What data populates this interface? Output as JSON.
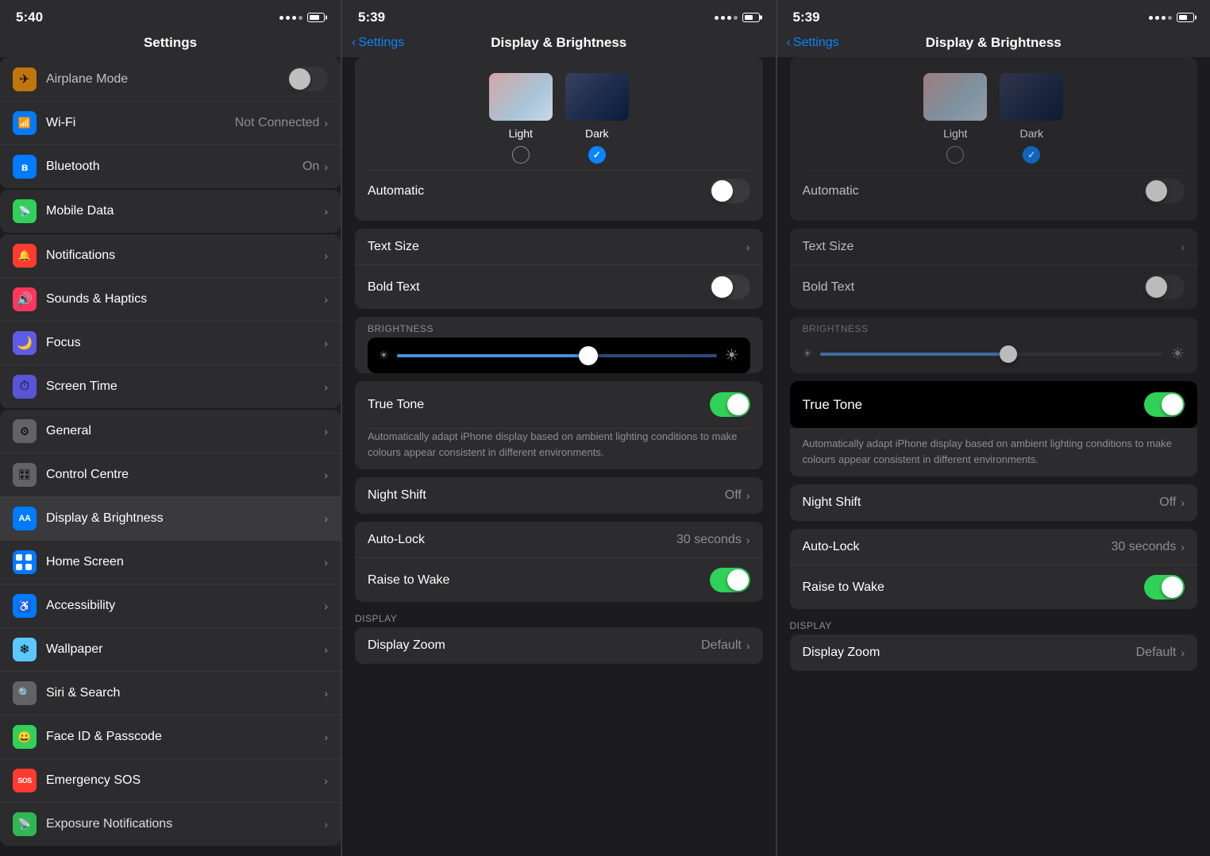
{
  "panels": [
    {
      "id": "panel-settings",
      "status": {
        "time": "5:40",
        "signal": [
          true,
          true,
          true,
          true
        ],
        "battery": 60
      },
      "hasBack": false,
      "title": "Settings",
      "sections": [
        {
          "items": [
            {
              "icon": "✈",
              "bg": "bg-orange",
              "label": "Airplane Mode",
              "value": "",
              "hasToggle": true,
              "toggleOn": false,
              "hasChevron": false
            },
            {
              "icon": "📶",
              "bg": "bg-blue",
              "label": "Wi-Fi",
              "value": "Not Connected",
              "hasChevron": true
            },
            {
              "icon": "🔵",
              "bg": "bg-blue",
              "label": "Bluetooth",
              "value": "On",
              "hasChevron": true
            }
          ]
        },
        {
          "items": [
            {
              "icon": "📱",
              "bg": "bg-green",
              "label": "Mobile Data",
              "value": "",
              "hasChevron": true
            }
          ]
        },
        {
          "items": [
            {
              "icon": "🔔",
              "bg": "bg-red",
              "label": "Notifications",
              "value": "",
              "hasChevron": true
            },
            {
              "icon": "🔊",
              "bg": "bg-pink",
              "label": "Sounds & Haptics",
              "value": "",
              "hasChevron": true
            },
            {
              "icon": "🌙",
              "bg": "bg-indigo",
              "label": "Focus",
              "value": "",
              "hasChevron": true
            },
            {
              "icon": "⏱",
              "bg": "bg-purple",
              "label": "Screen Time",
              "value": "",
              "hasChevron": true
            }
          ]
        },
        {
          "items": [
            {
              "icon": "⚙",
              "bg": "bg-gray",
              "label": "General",
              "value": "",
              "hasChevron": true
            },
            {
              "icon": "🎛",
              "bg": "bg-gray",
              "label": "Control Centre",
              "value": "",
              "hasChevron": true
            },
            {
              "icon": "AA",
              "bg": "bg-aa",
              "label": "Display & Brightness",
              "value": "",
              "hasChevron": true,
              "selected": true
            },
            {
              "icon": "⊞",
              "bg": "bg-blue",
              "label": "Home Screen",
              "value": "",
              "hasChevron": true
            },
            {
              "icon": "♿",
              "bg": "bg-blue",
              "label": "Accessibility",
              "value": "",
              "hasChevron": true
            },
            {
              "icon": "❄",
              "bg": "bg-cyan",
              "label": "Wallpaper",
              "value": "",
              "hasChevron": true
            },
            {
              "icon": "🔍",
              "bg": "bg-gray",
              "label": "Siri & Search",
              "value": "",
              "hasChevron": true
            },
            {
              "icon": "😀",
              "bg": "bg-green",
              "label": "Face ID & Passcode",
              "value": "",
              "hasChevron": true
            },
            {
              "icon": "SOS",
              "bg": "bg-red",
              "label": "Emergency SOS",
              "value": "",
              "hasChevron": true
            },
            {
              "icon": "📡",
              "bg": "bg-green",
              "label": "Exposure Notifications",
              "value": "",
              "hasChevron": true
            }
          ]
        }
      ]
    },
    {
      "id": "panel-display-1",
      "status": {
        "time": "5:39",
        "signal": [
          true,
          true,
          true,
          false
        ],
        "battery": 50
      },
      "hasBack": true,
      "backLabel": "Settings",
      "title": "Display & Brightness",
      "appearance": {
        "lightLabel": "Light",
        "darkLabel": "Dark",
        "selectedMode": "dark",
        "automaticLabel": "Automatic",
        "automaticOn": false
      },
      "textSection": {
        "textSizeLabel": "Text Size",
        "boldTextLabel": "Bold Text",
        "boldTextOn": false
      },
      "brightness": {
        "sectionLabel": "BRIGHTNESS",
        "sliderPercent": 55
      },
      "trueTone": {
        "label": "True Tone",
        "on": true,
        "description": "Automatically adapt iPhone display based on ambient lighting conditions to make colours appear consistent in different environments."
      },
      "nightShift": {
        "label": "Night Shift",
        "value": "Off"
      },
      "autoLock": {
        "label": "Auto-Lock",
        "value": "30 seconds"
      },
      "raiseToWake": {
        "label": "Raise to Wake",
        "on": true
      },
      "displaySection": {
        "sectionLabel": "DISPLAY",
        "displayZoom": {
          "label": "Display Zoom",
          "value": "Default"
        }
      }
    },
    {
      "id": "panel-display-2",
      "status": {
        "time": "5:39",
        "signal": [
          true,
          true,
          true,
          false
        ],
        "battery": 50
      },
      "hasBack": true,
      "backLabel": "Settings",
      "title": "Display & Brightness",
      "appearance": {
        "lightLabel": "Light",
        "darkLabel": "Dark",
        "selectedMode": "dark",
        "automaticLabel": "Automatic",
        "automaticOn": false
      },
      "textSection": {
        "textSizeLabel": "Text Size",
        "boldTextLabel": "Bold Text",
        "boldTextOn": false
      },
      "brightness": {
        "sectionLabel": "BRIGHTNESS",
        "sliderPercent": 55
      },
      "trueTone": {
        "label": "True Tone",
        "on": true,
        "description": "Automatically adapt iPhone display based on ambient lighting conditions to make colours appear consistent in different environments."
      },
      "nightShift": {
        "label": "Night Shift",
        "value": "Off"
      },
      "autoLock": {
        "label": "Auto-Lock",
        "value": "30 seconds"
      },
      "raiseToWake": {
        "label": "Raise to Wake",
        "on": true
      },
      "displaySection": {
        "sectionLabel": "DISPLAY",
        "displayZoom": {
          "label": "Display Zoom",
          "value": "Default"
        }
      }
    }
  ]
}
